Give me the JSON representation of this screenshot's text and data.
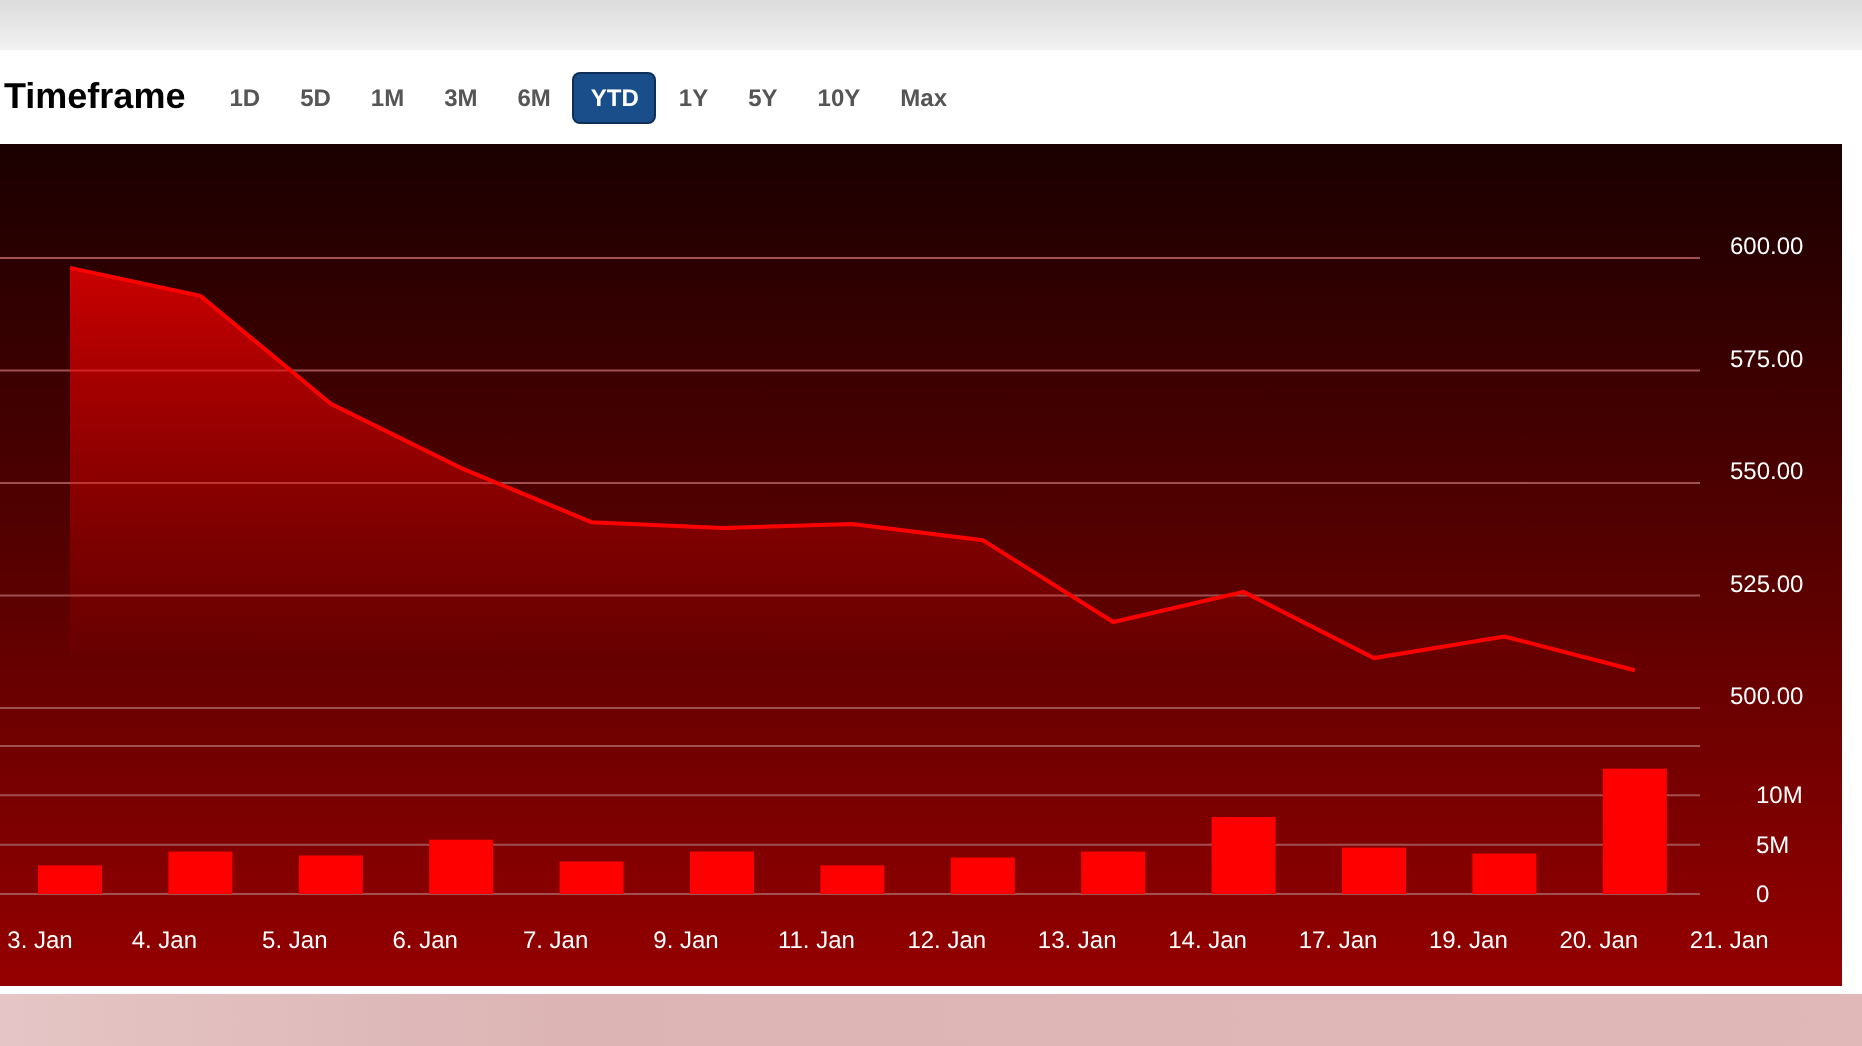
{
  "title": "Timeframe",
  "ranges": [
    {
      "label": "1D",
      "selected": false
    },
    {
      "label": "5D",
      "selected": false
    },
    {
      "label": "1M",
      "selected": false
    },
    {
      "label": "3M",
      "selected": false
    },
    {
      "label": "6M",
      "selected": false
    },
    {
      "label": "YTD",
      "selected": true
    },
    {
      "label": "1Y",
      "selected": false
    },
    {
      "label": "5Y",
      "selected": false
    },
    {
      "label": "10Y",
      "selected": false
    },
    {
      "label": "Max",
      "selected": false
    }
  ],
  "price_chart": {
    "chart_data": {
      "type": "area",
      "grid": true,
      "series": [
        {
          "color": "#ff0000",
          "values": [
            597.8,
            591.6,
            567.6,
            553.3,
            541.3,
            540,
            540.9,
            537.3,
            519.1,
            525.8,
            511.1,
            515.9,
            508.4
          ]
        }
      ],
      "ylim": [
        500,
        600
      ],
      "yticks": [
        {
          "value": 500,
          "label": "500.00"
        },
        {
          "value": 525,
          "label": "525.00"
        },
        {
          "value": 550,
          "label": "550.00"
        },
        {
          "value": 575,
          "label": "575.00"
        },
        {
          "value": 600,
          "label": "600.00"
        }
      ]
    }
  },
  "volume_chart": {
    "chart_data": {
      "type": "bar",
      "grid": true,
      "categories": [
        "3. Jan",
        "4. Jan",
        "5. Jan",
        "6. Jan",
        "7. Jan",
        "9. Jan",
        "11. Jan",
        "12. Jan",
        "13. Jan",
        "14. Jan",
        "17. Jan",
        "19. Jan",
        "20. Jan",
        "21. Jan"
      ],
      "series": [
        {
          "color": "#ff0000",
          "values": [
            2.9,
            4.3,
            3.9,
            5.5,
            3.3,
            4.3,
            2.9,
            3.7,
            4.3,
            7.8,
            4.7,
            4.1,
            12.7,
            null
          ]
        }
      ],
      "ylim": [
        0,
        15
      ],
      "yticks": [
        {
          "value": 0,
          "label": "0"
        },
        {
          "value": 5,
          "label": "5M"
        },
        {
          "value": 10,
          "label": "10M"
        }
      ]
    }
  }
}
